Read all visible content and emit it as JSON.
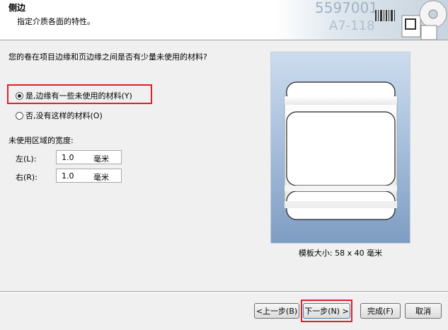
{
  "header": {
    "title": "侧边",
    "subtitle": "指定介质各面的特性。",
    "banner_text_1": "5597001",
    "banner_text_2": "A7-118"
  },
  "question": "您的卷在项目边缘和页边缘之间是否有少量未使用的材料?",
  "options": [
    {
      "label": "是,边缘有一些未使用的材料(Y)",
      "checked": true
    },
    {
      "label": "否,没有这样的材料(O)",
      "checked": false
    }
  ],
  "unused_width": {
    "label": "未使用区域的宽度:",
    "left": {
      "label": "左(L):",
      "value": "1.0",
      "unit": "毫米"
    },
    "right": {
      "label": "右(R):",
      "value": "1.0",
      "unit": "毫米"
    }
  },
  "preview": {
    "caption": "模板大小:  58 x 40 毫米"
  },
  "buttons": {
    "back": "<上一步(B)",
    "next": "下一步(N) >",
    "finish": "完成(F)",
    "cancel": "取消"
  },
  "colors": {
    "highlight": "#e0202c"
  }
}
